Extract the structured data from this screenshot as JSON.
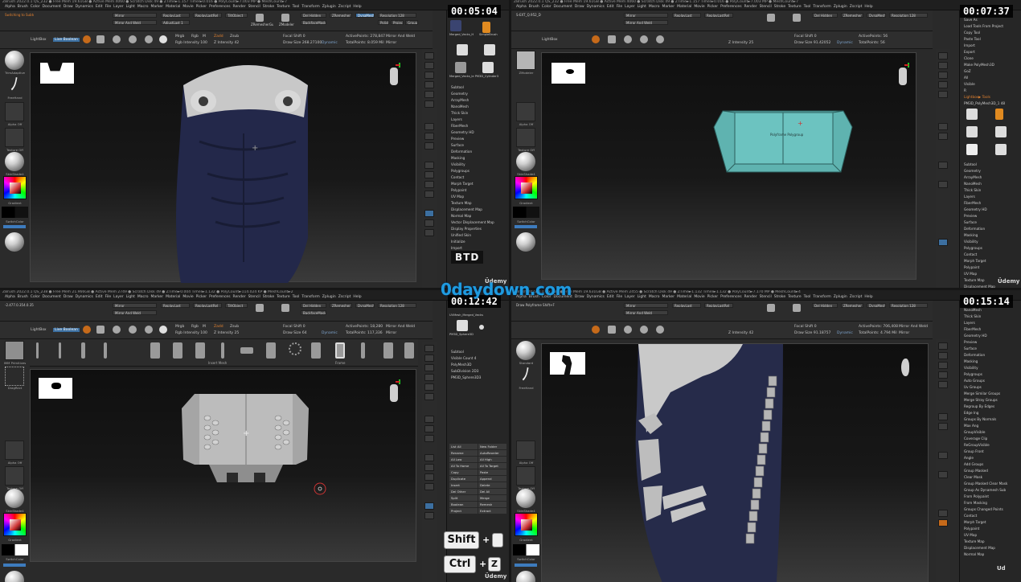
{
  "watermark": "0daydown.com",
  "q1": {
    "timer": "00:05:04",
    "title": "ZBrush 2022.0.1",
    "project": "QS_232",
    "menu_stats": "● Free Mem 19.61GB ● Active Mem 4060 ● Scratch Disk 49 ● ZTime►1.157 Timer►0.016 ● PolyCount►7.003 MP ● MeshCount►7",
    "menus": [
      "Alpha",
      "Brush",
      "Color",
      "Document",
      "Draw",
      "Dynamics",
      "Edit",
      "File",
      "Layer",
      "Light",
      "Macro",
      "Marker",
      "Material",
      "Movie",
      "Picker",
      "Preferences",
      "Render",
      "Stencil",
      "Stroke",
      "Texture",
      "Tool",
      "Transform",
      "Zplugin",
      "Zscript",
      "Help"
    ],
    "quicksave": "QuickSave",
    "seethrough": "See-through 0",
    "default_script": "DefaultZScript",
    "status_line": "Switching to Subtool: ▶ Merged_Vecks_HumanMaleAverage5",
    "toolbar": {
      "mirror": "Mirror",
      "mirror_weld": "Mirror And Weld",
      "replay_last": "ReplayLast",
      "replay_last_rel": "ReplayLastRel",
      "tilt_object": "TiltObject",
      "adjust_last": "AdjustLast 1",
      "zremesher_guide": "ZRemesherGuide",
      "zmodeler": "ZModeler",
      "del_hidden": "Del Hidden",
      "backface_mask": "BackfaceMask",
      "zremesher": "ZRemesher",
      "dynamesh": "DynaMesh",
      "resolution": "Resolution 128",
      "polish": "Polish",
      "project": "Project",
      "groups": "Groups"
    },
    "strip": {
      "lightbox": "LightBox",
      "live_boolean": "Live Boolean",
      "edit": "Edit",
      "move": "Move",
      "scale": "Scale",
      "rotate": "Rotate",
      "mrgb": "Mrgb",
      "rgb": "Rgb",
      "m": "M",
      "zadd": "Zadd",
      "zsub": "Zsub",
      "rgb_intensity": "Rgb Intensity 100",
      "z_intensity": "Z Intensity 42",
      "focal_shift": "Focal Shift 0",
      "draw_size": "Draw Size 268.27100",
      "dynamic": "Dynamic",
      "active_points": "ActivePoints: 278,847",
      "total_points": "TotalPoints: 8.059 Mil",
      "mirror_weld": "Mirror And Weld",
      "mirror": "Mirror"
    },
    "left": {
      "brush": "TrimAdaptive",
      "stroke": "FreeHand",
      "alpha": "Alpha Off",
      "texture": "Texture Off",
      "material": "SkinShade4",
      "gradient": "Gradient",
      "switch_color": "SwitchColor"
    },
    "right_panel": {
      "tools": [
        "Merged_Vecks_H",
        "SimpleBrush",
        "Merged_Sphere3D",
        "Merged_Vecks_le",
        "UVMesh_Merged_Vecks",
        "PM3D_Cylinder3",
        "Merged_Vecks_le PM3D_Cylinder3"
      ],
      "items": [
        "Subtool",
        "Geometry",
        "ArrayMesh",
        "NanoMesh",
        "Thick Skin",
        "Layers",
        "FiberMesh",
        "Geometry HD",
        "Preview",
        "Surface",
        "Deformation",
        "Masking",
        "Visibility",
        "Polygroups",
        "Contact",
        "Morph Target",
        "Polypaint",
        "UV Map",
        "Texture Map",
        "Displacement Map",
        "Normal Map",
        "Vector Displacement Map",
        "Display Properties",
        "Unified Skin",
        "Initialize",
        "Import",
        "Export"
      ]
    },
    "btd_badge": "BTD",
    "udemy": "Üdemy"
  },
  "q2": {
    "timer": "00:07:37",
    "title": "ZBrush 2022.0.1",
    "project": "QS_232",
    "menu_stats": "● Free Mem 19.61GB ● Active Mem 4060 ● Scratch Disk 49 ● ZTime►1.157 Timer►0.016 ● PolyCount►7.003 MP ● MeshCount►7",
    "status_line": "S-EXT_Q.952_D",
    "strip": {
      "lightbox": "LightBox",
      "focal_shift": "Focal Shift 0",
      "draw_size": "Draw Size 91.42052",
      "z_intensity": "Z Intensity 25",
      "active_points": "ActivePoints: 56",
      "total_points": "TotalPoints: 56",
      "dynamic": "Dynamic"
    },
    "left": {
      "brush": "ZModeler",
      "alpha": "Alpha Off",
      "texture": "Texture Off",
      "material": "SkinShade4",
      "gradient": "Gradient",
      "switch_color": "SwitchColor"
    },
    "canvas_label": "Polyframe Polygroup",
    "tool_menu": [
      "Load Tool",
      "Save As",
      "Load Tools From Project",
      "Copy Tool",
      "Paste Tool",
      "Import",
      "Export",
      "Clone",
      "Make PolyMesh3D",
      "GoZ",
      "All",
      "Visible",
      "R"
    ],
    "lightbox_tools": "Lightbox▶ Tools",
    "pm3d": "PM3D_PolyMesh3D_1 48",
    "right_panel": {
      "tools": [
        "PM3D_PolyMesh",
        "SimpleBrush",
        "PM3D_Sphere3D",
        "Merged_Vecks_HumanMale",
        "UVMesh_Merged_Vecks",
        "PM3D_Cylinder3",
        "PolyMesh3D",
        "PM3D_Plane3D",
        "PM3D_PolyMesh"
      ],
      "items": [
        "Subtool",
        "Geometry",
        "ArrayMesh",
        "NanoMesh",
        "Thick Skin",
        "Layers",
        "FiberMesh",
        "Geometry HD",
        "Preview",
        "Surface",
        "Deformation",
        "Masking",
        "Visibility",
        "Polygroups",
        "Contact",
        "Morph Target",
        "Polypaint",
        "UV Map",
        "Texture Map",
        "Displacement Map"
      ]
    },
    "udemy": "Üdemy"
  },
  "q3": {
    "timer": "00:12:42",
    "title": "ZBrush 2022.0.1",
    "project": "QS_238",
    "menu_stats": "● Free Mem 21.966GB ● Active Mem 2749 ● Scratch Disk 49 ● ZTime►0.004 Timer►1.132 ● PolyCount►114.024 KP ● MeshCount►2",
    "status_line": "-2.477.0.354.0.353",
    "strip": {
      "lightbox": "LightBox",
      "live_boolean": "Live Boolean",
      "mrgb": "Mrgb",
      "rgb": "Rgb",
      "m": "M",
      "zadd": "Zadd",
      "zsub": "Zsub",
      "rgb_intensity": "Rgb Intensity 100",
      "z_intensity": "Z Intensity 25",
      "focal_shift": "Focal Shift 0",
      "draw_size": "Draw Size 64",
      "dynamic": "Dynamic",
      "active_points": "ActivePoints: 18,280",
      "total_points": "TotalPoints: 117,336",
      "mirror_weld": "Mirror And Weld",
      "mirror": "Mirror"
    },
    "brush_row_label": "Insert Mesh",
    "frame_label": "Frame",
    "left": {
      "brush": "IMM Primitives",
      "stroke": "DragRect",
      "alpha": "Alpha Off",
      "texture": "Texture Off",
      "material": "SkinShade4",
      "gradient": "Gradient",
      "switch_color": "SwitchColor"
    },
    "right_panel": {
      "tools": [
        "UVMesh_Merged_Vecks",
        "PM3D_Cylinder3",
        "PM3D_Sphere3D"
      ],
      "subtool": "Subtool",
      "visible_count": "Visible Count 4",
      "subtool_items": [
        "PolyMesh3D",
        "SubDivision 2D3",
        "PM3D_Sphere3D3"
      ],
      "buttons": [
        "List All",
        "New Folder",
        "Rename",
        "AutoReorder",
        "All Low",
        "All High",
        "All To Home",
        "All To Target",
        "Copy",
        "Paste",
        "Duplicate",
        "Append",
        "Insert",
        "Delete",
        "Del Other",
        "Del All",
        "Split",
        "Merge",
        "Boolean",
        "Remesh",
        "Project",
        "Extract"
      ]
    },
    "keys": {
      "shift": "Shift",
      "ctrl": "Ctrl",
      "z": "Z",
      "plus": "+"
    },
    "udemy": "Üdemy"
  },
  "q4": {
    "timer": "00:15:14",
    "title": "ZBrush 2022.0.1",
    "project": "QS_232",
    "menu_stats": "● Free Mem 19.631GB ● Active Mem 2455 ● Scratch Disk 49 ● ZTime►1.132 Timer►1.132 ● PolyCount►7.170 MP ● MeshCount►4",
    "status_line": "Draw Polyframe Shift+F",
    "strip": {
      "focal_shift": "Focal Shift 0",
      "draw_size": "Draw Size 91.18757",
      "z_intensity": "Z Intensity 42",
      "active_points": "ActivePoints: 706,408",
      "total_points": "TotalPoints: 4.794 Mil",
      "dynamic": "Dynamic",
      "mirror_weld": "Mirror And Weld",
      "mirror": "Mirror"
    },
    "left": {
      "brush": "Standard",
      "stroke": "FreeHand",
      "alpha": "Alpha Off",
      "texture": "Texture Off",
      "material": "SkinShade4",
      "gradient": "Gradient",
      "switch_color": "SwitchColor"
    },
    "right_panel": {
      "items": [
        "ArrayMesh",
        "NanoMesh",
        "Thick Skin",
        "Layers",
        "FiberMesh",
        "Geometry HD",
        "Preview",
        "Surface",
        "Deformation",
        "Masking",
        "Visibility",
        "Polygroups",
        "Auto Groups",
        "Uv Groups",
        "Merge Similar Groups",
        "Merge Stray Groups",
        "Regroup By Edges",
        "Edge Ing",
        "Groups By Normals",
        "Max Ang",
        "GroupVisible",
        "Coverage Clip",
        "ReGroupVisible",
        "Group Front",
        "Angle",
        "Add Groups",
        "Group Masked",
        "Clear Mask",
        "Group Masked Clear Mask",
        "Group As Dynamesh Sub",
        "From Polypaint",
        "From Masking",
        "Groups Changed Points",
        "Contact",
        "Morph Target",
        "Polypaint",
        "UV Map",
        "Texture Map",
        "Displacement Map",
        "Normal Map"
      ]
    },
    "udemy": "Ud"
  }
}
